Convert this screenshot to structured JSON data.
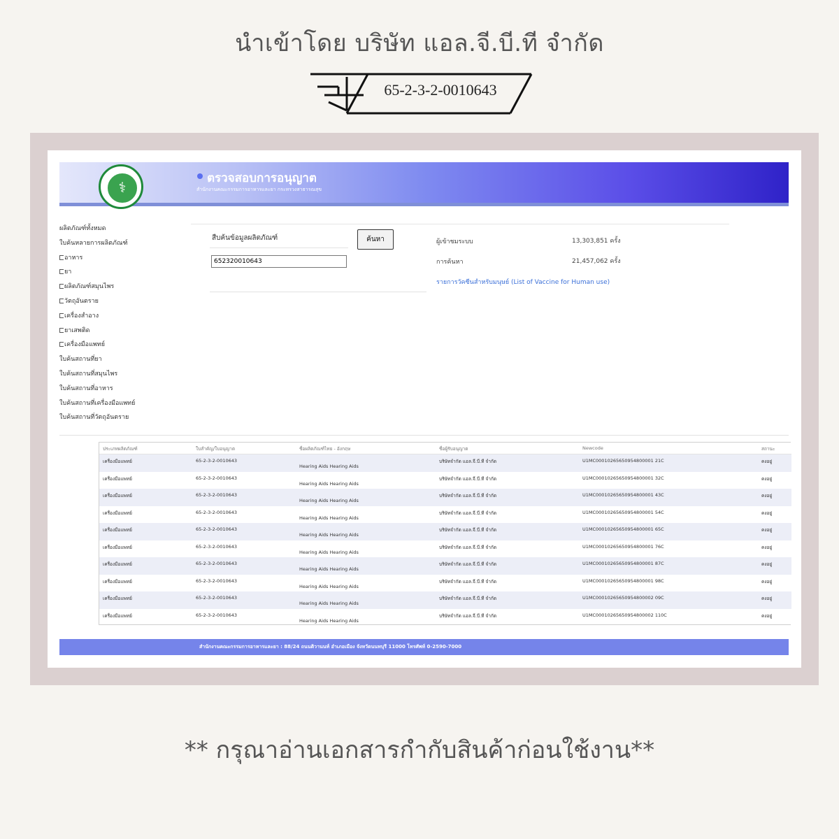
{
  "import_line": "นำเข้าโดย บริษัท แอล.จี.บี.ที จำกัด",
  "fda_number": "65-2-3-2-0010643",
  "banner": {
    "title": "ตรวจสอบการอนุญาต",
    "subtitle": "สำนักงานคณะกรรมการอาหารและยา กระทรวงสาธารณสุข",
    "logo_icon": "caduceus-icon"
  },
  "sidebar": {
    "items": [
      {
        "label": "ผลิตภัณฑ์ทั้งหมด",
        "checkbox": false
      },
      {
        "label": "ใบค้นหลายการผลิตภัณฑ์",
        "checkbox": false
      },
      {
        "label": "อาหาร",
        "checkbox": true
      },
      {
        "label": "ยา",
        "checkbox": true
      },
      {
        "label": "ผลิตภัณฑ์สมุนไพร",
        "checkbox": true
      },
      {
        "label": "วัตถุอันตราย",
        "checkbox": true
      },
      {
        "label": "เครื่องสำอาง",
        "checkbox": true
      },
      {
        "label": "ยาเสพติด",
        "checkbox": true
      },
      {
        "label": "เครื่องมือแพทย์",
        "checkbox": true
      },
      {
        "label": "ใบค้นสถานที่ยา",
        "checkbox": false
      },
      {
        "label": "ใบค้นสถานที่สมุนไพร",
        "checkbox": false
      },
      {
        "label": "ใบค้นสถานที่อาหาร",
        "checkbox": false
      },
      {
        "label": "ใบค้นสถานที่เครื่องมือแพทย์",
        "checkbox": false
      },
      {
        "label": "ใบค้นสถานที่วัตถุอันตราย",
        "checkbox": false
      }
    ]
  },
  "search": {
    "label": "สืบค้นข้อมูลผลิตภัณฑ์",
    "value": "652320010643",
    "button": "ค้นหา"
  },
  "stats": {
    "visitors_label": "ผู้เข้าชมระบบ",
    "visitors_value": "13,303,851 ครั้ง",
    "searches_label": "การค้นหา",
    "searches_value": "21,457,062 ครั้ง",
    "vaccine_link": "รายการวัคซีนสำหรับมนุษย์ (List of Vaccine for Human use)"
  },
  "table": {
    "headers": [
      "ประเภทผลิตภัณฑ์",
      "ใบสำคัญ/ใบอนุญาต",
      "ชื่อผลิตภัณฑ์ไทย - อังกฤษ",
      "ชื่อผู้รับอนุญาต",
      "Newcode",
      "สถานะ"
    ],
    "rows": [
      [
        "เครื่องมือแพทย์",
        "65-2-3-2-0010643",
        "Hearing Aids Hearing Aids",
        "บริษัทจำกัด แอล.จี.บี.ที จำกัด",
        "U1MC00010265650954800001 21C",
        "คงอยู่"
      ],
      [
        "เครื่องมือแพทย์",
        "65-2-3-2-0010643",
        "Hearing Aids Hearing Aids",
        "บริษัทจำกัด แอล.จี.บี.ที จำกัด",
        "U1MC00010265650954800001 32C",
        "คงอยู่"
      ],
      [
        "เครื่องมือแพทย์",
        "65-2-3-2-0010643",
        "Hearing Aids Hearing Aids",
        "บริษัทจำกัด แอล.จี.บี.ที จำกัด",
        "U1MC00010265650954800001 43C",
        "คงอยู่"
      ],
      [
        "เครื่องมือแพทย์",
        "65-2-3-2-0010643",
        "Hearing Aids Hearing Aids",
        "บริษัทจำกัด แอล.จี.บี.ที จำกัด",
        "U1MC00010265650954800001 54C",
        "คงอยู่"
      ],
      [
        "เครื่องมือแพทย์",
        "65-2-3-2-0010643",
        "Hearing Aids Hearing Aids",
        "บริษัทจำกัด แอล.จี.บี.ที จำกัด",
        "U1MC00010265650954800001 65C",
        "คงอยู่"
      ],
      [
        "เครื่องมือแพทย์",
        "65-2-3-2-0010643",
        "Hearing Aids Hearing Aids",
        "บริษัทจำกัด แอล.จี.บี.ที จำกัด",
        "U1MC00010265650954800001 76C",
        "คงอยู่"
      ],
      [
        "เครื่องมือแพทย์",
        "65-2-3-2-0010643",
        "Hearing Aids Hearing Aids",
        "บริษัทจำกัด แอล.จี.บี.ที จำกัด",
        "U1MC00010265650954800001 87C",
        "คงอยู่"
      ],
      [
        "เครื่องมือแพทย์",
        "65-2-3-2-0010643",
        "Hearing Aids Hearing Aids",
        "บริษัทจำกัด แอล.จี.บี.ที จำกัด",
        "U1MC00010265650954800001 98C",
        "คงอยู่"
      ],
      [
        "เครื่องมือแพทย์",
        "65-2-3-2-0010643",
        "Hearing Aids Hearing Aids",
        "บริษัทจำกัด แอล.จี.บี.ที จำกัด",
        "U1MC00010265650954800002 09C",
        "คงอยู่"
      ],
      [
        "เครื่องมือแพทย์",
        "65-2-3-2-0010643",
        "Hearing Aids Hearing Aids",
        "บริษัทจำกัด แอล.จี.บี.ที จำกัด",
        "U1MC00010265650954800002 110C",
        "คงอยู่"
      ]
    ]
  },
  "footer": "สำนักงานคณะกรรมการอาหารและยา : 88/24 ถนนติวานนท์ อำเภอเมือง จังหวัดนนทบุรี 11000 โทรศัพท์ 0-2590-7000",
  "note": "** กรุณาอ่านเอกสารกำกับสินค้าก่อนใช้งาน**",
  "colors": {
    "background": "#f6f4f0",
    "frame": "#dbd0d0",
    "banner_gradient_end": "#2f22c8",
    "footer": "#7584ea",
    "link": "#3a6fd8",
    "logo_green": "#1f8a3a"
  }
}
